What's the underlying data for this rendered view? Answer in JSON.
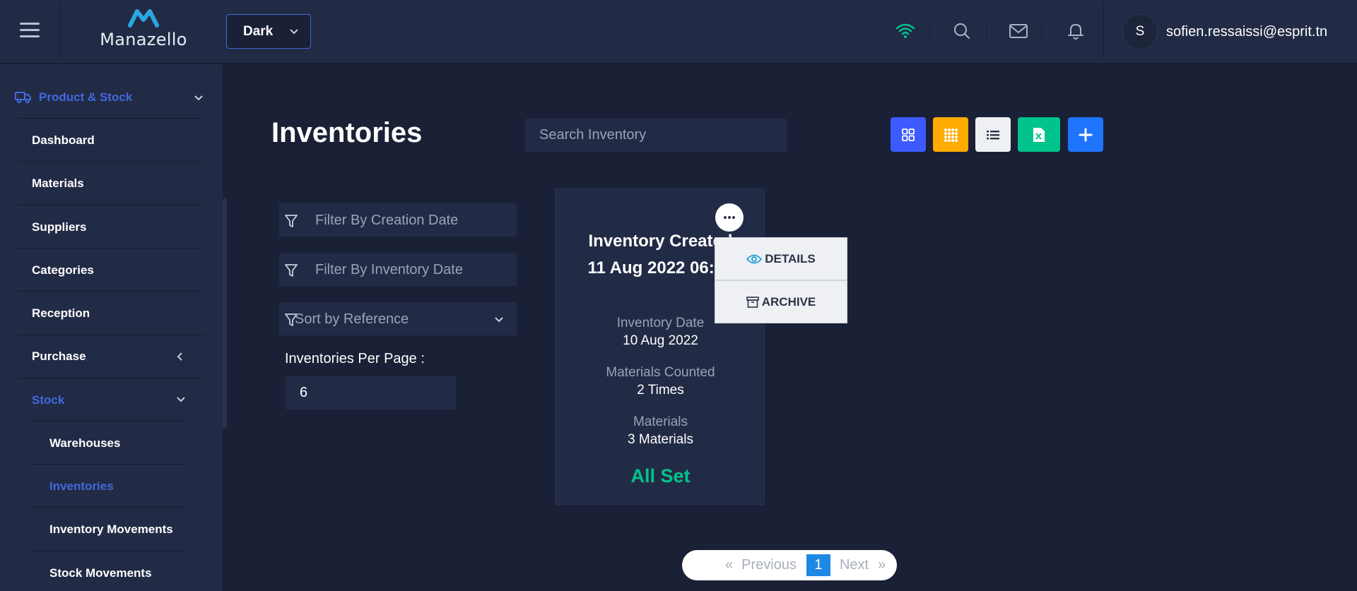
{
  "header": {
    "brand": "Manazello",
    "theme_selected": "Dark",
    "user_initial": "S",
    "user_email": "sofien.ressaissi@esprit.tn",
    "wifi_color": "#00c48c"
  },
  "sidebar": {
    "section": "Product & Stock",
    "items": [
      {
        "label": "Dashboard"
      },
      {
        "label": "Materials"
      },
      {
        "label": "Suppliers"
      },
      {
        "label": "Categories"
      },
      {
        "label": "Reception"
      },
      {
        "label": "Purchase"
      },
      {
        "label": "Stock"
      }
    ],
    "stock_items": [
      {
        "label": "Warehouses"
      },
      {
        "label": "Inventories"
      },
      {
        "label": "Inventory Movements"
      },
      {
        "label": "Stock Movements"
      }
    ],
    "active_color": "#3f6ae0"
  },
  "main": {
    "title": "Inventories",
    "search_placeholder": "Search Inventory",
    "filters": {
      "creation_date": "Filter By Creation Date",
      "inventory_date": "Filter By Inventory Date",
      "sort": "Sort by Reference"
    },
    "per_page_label": "Inventories Per Page :",
    "per_page_value": "6",
    "toolbar_colors": {
      "grid": "#3d5afe",
      "grid_small": "#ffab00",
      "list": "#eef0f4",
      "excel": "#00c48c",
      "add": "#1e74fd"
    }
  },
  "card": {
    "title": "Inventory Created",
    "created": "11 Aug 2022 06:27",
    "inventory_date_label": "Inventory Date",
    "inventory_date": "10 Aug 2022",
    "counted_label": "Materials Counted",
    "counted": "2 Times",
    "materials_label": "Materials",
    "materials": "3 Materials",
    "status": "All Set",
    "status_color": "#00c48c"
  },
  "menu": {
    "details": "DETAILS",
    "archive": "ARCHIVE"
  },
  "pagination": {
    "first": "«",
    "previous": "Previous",
    "current": "1",
    "next": "Next",
    "last": "»"
  }
}
